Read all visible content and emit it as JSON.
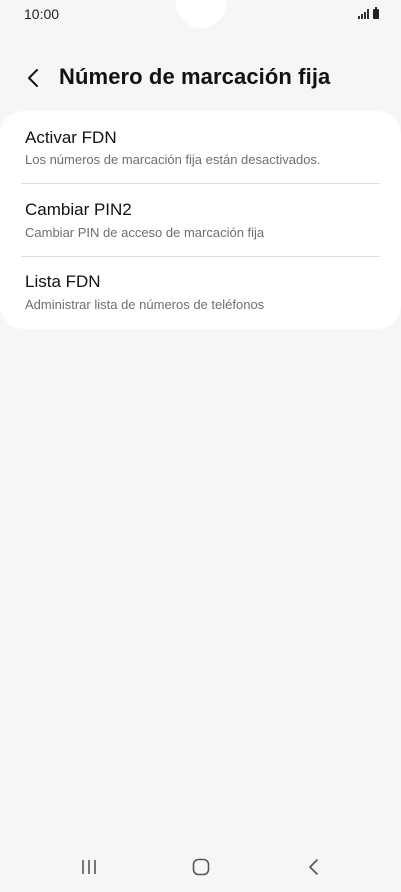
{
  "status_bar": {
    "time": "10:00",
    "icons": [
      "signal-icon",
      "battery-icon"
    ]
  },
  "header": {
    "back_icon": "back-arrow-icon",
    "title": "Número de marcación fija"
  },
  "settings_list": {
    "items": [
      {
        "title": "Activar FDN",
        "subtitle": "Los números de marcación fija están desactivados."
      },
      {
        "title": "Cambiar PIN2",
        "subtitle": "Cambiar PIN de acceso de marcación fija"
      },
      {
        "title": "Lista FDN",
        "subtitle": "Administrar lista de números de teléfonos"
      }
    ]
  },
  "nav_bar": {
    "buttons": [
      "recent-apps-icon",
      "home-icon",
      "back-icon"
    ]
  },
  "colors": {
    "background": "#f6f6f8",
    "card": "#ffffff",
    "title_text": "#111111",
    "subtitle_text": "#6f6f6f",
    "divider": "#dedede"
  }
}
